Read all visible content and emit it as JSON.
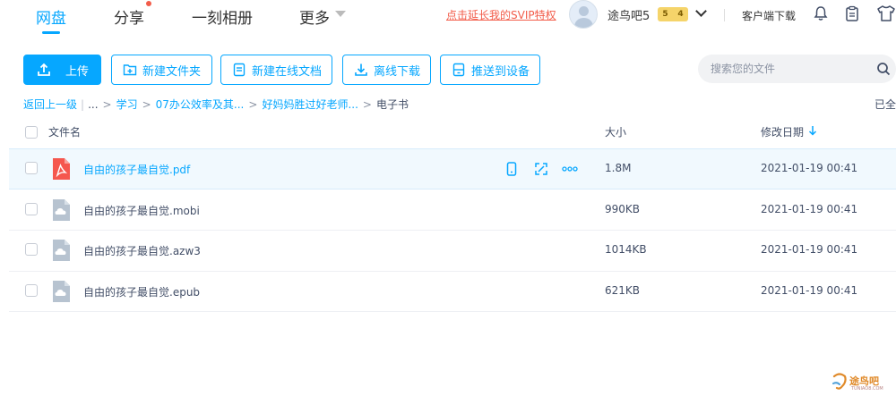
{
  "nav": {
    "tabs": [
      "网盘",
      "分享",
      "一刻相册",
      "更多"
    ],
    "svip_link": "点击延长我的SVIP特权",
    "username": "途鸟吧5",
    "level_left": "5",
    "level_right": "4",
    "client_download": "客户端下载"
  },
  "toolbar": {
    "upload": "上传",
    "new_folder": "新建文件夹",
    "new_online_doc": "新建在线文档",
    "offline_download": "离线下载",
    "push_to_device": "推送到设备",
    "search_placeholder": "搜索您的文件"
  },
  "breadcrumb": {
    "back": "返回上一级",
    "ellipsis": "...",
    "items": [
      "学习",
      "07办公效率及其...",
      "好妈妈胜过好老师...",
      "电子书"
    ],
    "loaded": "已全"
  },
  "table": {
    "headers": {
      "name": "文件名",
      "size": "大小",
      "date": "修改日期"
    },
    "rows": [
      {
        "name": "自由的孩子最自觉.pdf",
        "size": "1.8M",
        "date": "2021-01-19 00:41",
        "icon": "pdf-icon"
      },
      {
        "name": "自由的孩子最自觉.mobi",
        "size": "990KB",
        "date": "2021-01-19 00:41",
        "icon": "cloud-file-icon"
      },
      {
        "name": "自由的孩子最自觉.azw3",
        "size": "1014KB",
        "date": "2021-01-19 00:41",
        "icon": "cloud-file-icon"
      },
      {
        "name": "自由的孩子最自觉.epub",
        "size": "621KB",
        "date": "2021-01-19 00:41",
        "icon": "cloud-file-icon"
      }
    ]
  },
  "watermark": {
    "text": "途鸟吧",
    "url": "TUNIAO8.COM"
  },
  "colors": {
    "accent": "#06a7ff",
    "svip_red": "#f25c4a",
    "pdf_red": "#f5574e"
  }
}
